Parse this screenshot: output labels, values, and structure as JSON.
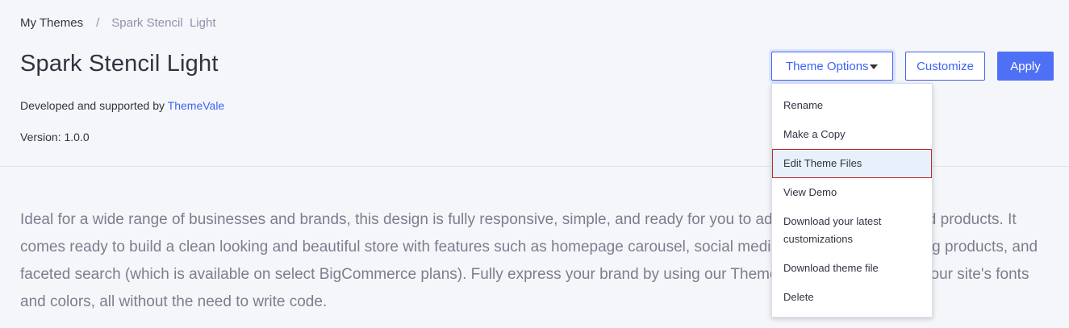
{
  "breadcrumb": {
    "parent": "My Themes",
    "separator": "/",
    "current": "Spark Stencil  Light"
  },
  "theme": {
    "title": "Spark Stencil Light",
    "developed_prefix": "Developed and supported by ",
    "developer": "ThemeVale",
    "version": "Version: 1.0.0",
    "description": "Ideal for a wide range of businesses and brands, this design is fully responsive, simple, and ready for you to add your own imagery and products. It comes ready to build a clean looking and beautiful store with features such as homepage carousel, social media integration, best selling products, and faceted search (which is available on select BigCommerce plans). Fully express your brand by using our Theme Editor to easily style your site's fonts and colors, all without the need to write code."
  },
  "actions": {
    "theme_options": "Theme Options",
    "customize": "Customize",
    "apply": "Apply"
  },
  "menu": {
    "items": [
      {
        "label": "Rename"
      },
      {
        "label": "Make a Copy"
      },
      {
        "label": "Edit Theme Files"
      },
      {
        "label": "View Demo"
      },
      {
        "label": "Download your latest customizations"
      },
      {
        "label": "Download theme file"
      },
      {
        "label": "Delete"
      }
    ],
    "active_index": 2
  },
  "colors": {
    "accent": "#3c64f4",
    "apply_bg": "#4e70f5",
    "active_outline": "#c7252f"
  }
}
